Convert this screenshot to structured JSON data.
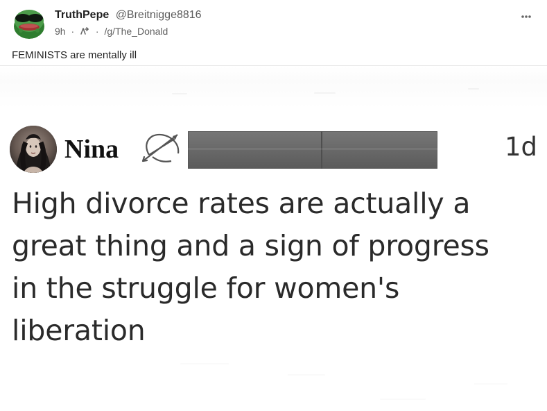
{
  "post": {
    "author": {
      "display_name": "TruthPepe",
      "handle": "@Breitnigge8816"
    },
    "meta": {
      "age": "9h",
      "community": "/g/The_Donald"
    },
    "text": "FEMINISTS are mentally ill",
    "icons": {
      "avatar": "pepe-avatar",
      "community": "community-icon",
      "menu": "more-horizontal-icon"
    }
  },
  "embedded_tweet": {
    "name": "Nina",
    "time": "1d",
    "lines": [
      "High divorce rates are actually a",
      "great thing and a sign of progress",
      "in the struggle for women's",
      "liberation"
    ],
    "icons": {
      "avatar": "profile-photo",
      "zodiac": "sagittarius-icon",
      "redaction": "redacted-handle-bar"
    }
  }
}
